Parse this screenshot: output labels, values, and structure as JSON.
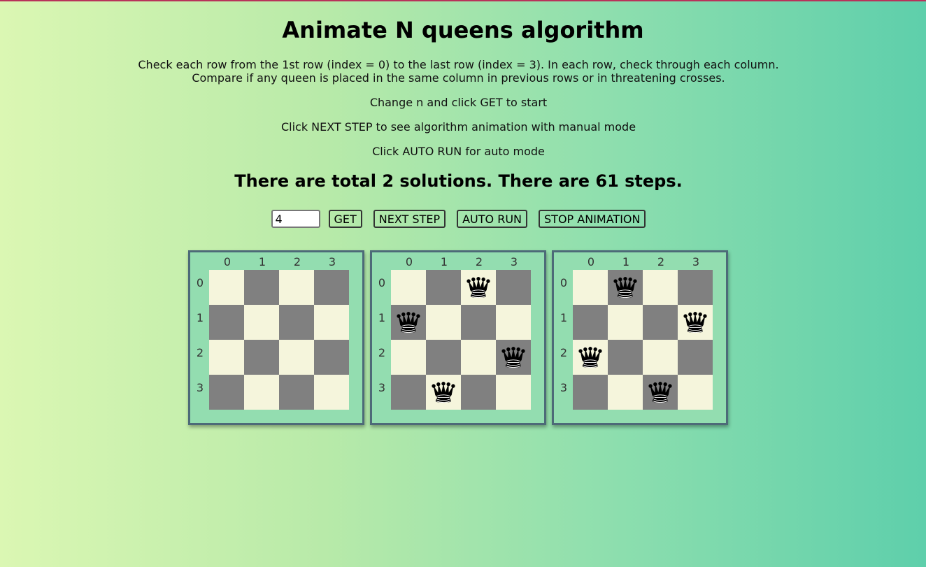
{
  "title": "Animate N queens algorithm",
  "instructions": {
    "line1": "Check each row from the 1st row (index = 0) to the last row (index = 3). In each row, check through each column.",
    "line2": "Compare if any queen is placed in the same column in previous rows or in threatening crosses.",
    "line3": "Change n and click GET to start",
    "line4": "Click NEXT STEP to see algorithm animation with manual mode",
    "line5": "Click AUTO RUN for auto mode"
  },
  "summary": "There are total 2 solutions. There are 61 steps.",
  "controls": {
    "n_value": "4",
    "get_label": "GET",
    "next_step_label": "NEXT STEP",
    "auto_run_label": "AUTO RUN",
    "stop_label": "STOP ANIMATION"
  },
  "axis_labels": [
    "0",
    "1",
    "2",
    "3"
  ],
  "boards": [
    {
      "queens": [
        null,
        null,
        null,
        null
      ]
    },
    {
      "queens": [
        2,
        0,
        3,
        1
      ]
    },
    {
      "queens": [
        1,
        3,
        0,
        2
      ]
    }
  ],
  "colors": {
    "light_square": "#f5f5dc",
    "dark_square": "#808080",
    "board_bg": "#93ddb0"
  },
  "icons": {
    "queen": "queen-icon"
  }
}
